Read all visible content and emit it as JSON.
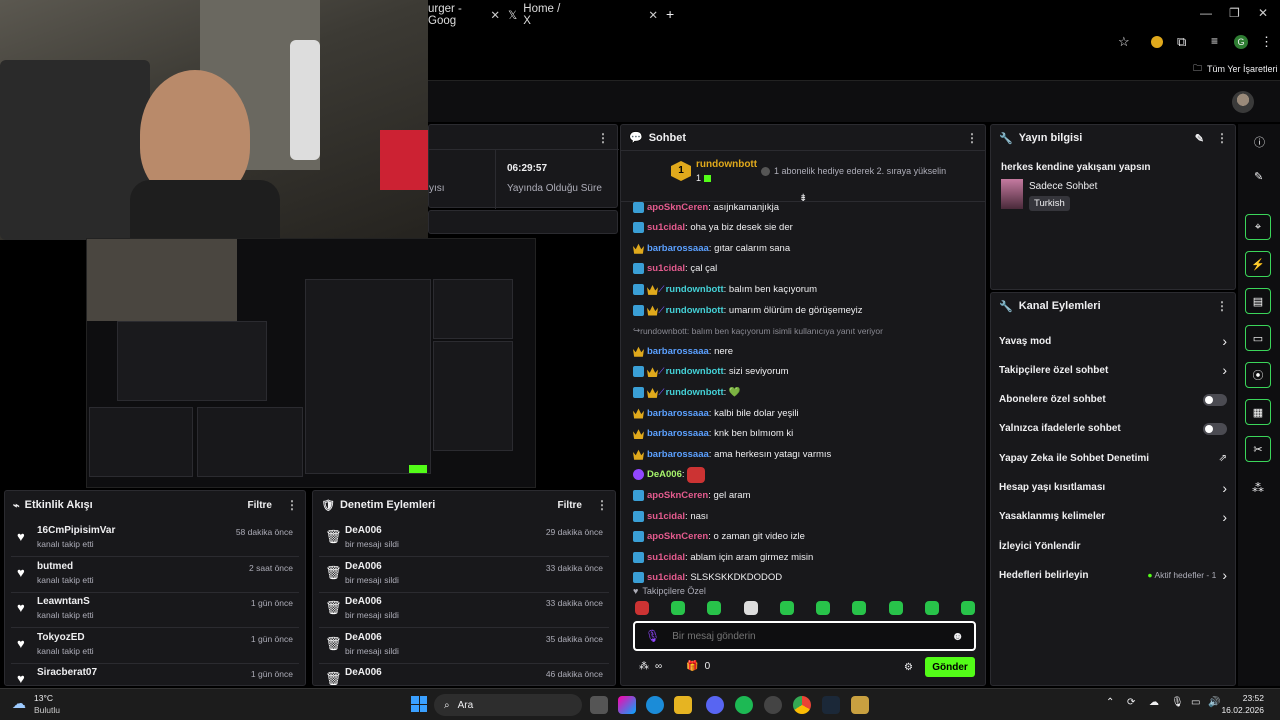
{
  "browser": {
    "tabs": [
      {
        "label": "urger - Goog"
      },
      {
        "label": "Home / X"
      }
    ],
    "bookmarks_label": "Tüm Yer İşaretleri",
    "profile_initial": "G"
  },
  "stats": {
    "uptime_value": "06:29:57",
    "uptime_label": "Yayında Olduğu Süre",
    "left_partial": "yısı"
  },
  "chat": {
    "title": "Sohbet",
    "pinned": {
      "rank": "1",
      "user": "rundownbott",
      "sub": "1",
      "text": "1 abonelik hediye ederek 2. sıraya yükselin"
    },
    "messages": [
      {
        "user": "apoSknCeren",
        "text": "asıjnkamanjıkja",
        "badges": [
          "blue"
        ],
        "color": "u-pink"
      },
      {
        "user": "su1cidal",
        "text": "oha ya biz desek sie der",
        "badges": [
          "blue"
        ],
        "color": "u-pink"
      },
      {
        "user": "barbarossaaa",
        "text": "gıtar calarım sana",
        "badges": [
          "gold"
        ],
        "color": "u-blue"
      },
      {
        "user": "su1cidal",
        "text": "çal çal",
        "badges": [
          "blue"
        ],
        "color": "u-pink"
      },
      {
        "user": "rundownbott",
        "text": "balım ben kaçıyorum",
        "badges": [
          "blue",
          "gold"
        ],
        "color": "u-cyan",
        "mod": true
      },
      {
        "user": "rundownbott",
        "text": "umarım ölürüm de görüşemeyiz",
        "badges": [
          "blue",
          "gold"
        ],
        "color": "u-cyan",
        "mod": true
      },
      {
        "reply": "rundownbott: balım ben kaçıyorum isimli kullanıcıya yanıt veriyor"
      },
      {
        "user": "barbarossaaa",
        "text": "nere",
        "badges": [
          "gold"
        ],
        "color": "u-blue"
      },
      {
        "user": "rundownbott",
        "text": "sizi seviyorum",
        "badges": [
          "blue",
          "gold"
        ],
        "color": "u-cyan",
        "mod": true
      },
      {
        "user": "rundownbott",
        "text": "💚",
        "badges": [
          "blue",
          "gold"
        ],
        "color": "u-cyan",
        "mod": true
      },
      {
        "user": "barbarossaaa",
        "text": "kalbi bile dolar yeşili",
        "badges": [
          "gold"
        ],
        "color": "u-blue"
      },
      {
        "user": "barbarossaaa",
        "text": "knk ben bılmıom ki",
        "badges": [
          "gold"
        ],
        "color": "u-blue"
      },
      {
        "user": "barbarossaaa",
        "text": "ama herkesın yatagı varmıs",
        "badges": [
          "gold"
        ],
        "color": "u-blue"
      },
      {
        "user": "DeA006",
        "text": "",
        "badges": [
          "mic"
        ],
        "color": "u-lime",
        "emote": true
      },
      {
        "user": "apoSknCeren",
        "text": "gel aram",
        "badges": [
          "blue"
        ],
        "color": "u-pink"
      },
      {
        "user": "su1cidal",
        "text": "nası",
        "badges": [
          "blue"
        ],
        "color": "u-pink"
      },
      {
        "user": "apoSknCeren",
        "text": "o zaman git video izle",
        "badges": [
          "blue"
        ],
        "color": "u-pink"
      },
      {
        "user": "su1cidal",
        "text": "ablam için aram girmez misin",
        "badges": [
          "blue"
        ],
        "color": "u-pink"
      },
      {
        "user": "su1cidal",
        "text": "SLSKSKKDKDODOD",
        "badges": [
          "blue"
        ],
        "color": "u-pink"
      }
    ],
    "followers_only_label": "Takipçilere Özel",
    "input_placeholder": "Bir mesaj gönderin",
    "infinity": "∞",
    "gift_count": "0",
    "send_label": "Gönder"
  },
  "stream_info": {
    "title": "Yayın bilgisi",
    "stream_title": "herkes kendine yakışanı yapsın",
    "category": "Sadece Sohbet",
    "tag": "Turkish"
  },
  "channel_actions": {
    "title": "Kanal Eylemleri",
    "rows": [
      {
        "label": "Yavaş mod",
        "control": "chevron"
      },
      {
        "label": "Takipçilere özel sohbet",
        "control": "chevron"
      },
      {
        "label": "Abonelere özel sohbet",
        "control": "toggle"
      },
      {
        "label": "Yalnızca ifadelerle sohbet",
        "control": "toggle"
      },
      {
        "label": "Yapay Zeka ile Sohbet Denetimi",
        "control": "external"
      },
      {
        "label": "Hesap yaşı kısıtlaması",
        "control": "chevron"
      },
      {
        "label": "Yasaklanmış kelimeler",
        "control": "chevron"
      },
      {
        "label": "İzleyici Yönlendir",
        "control": "none"
      },
      {
        "label": "Hedefleri belirleyin",
        "control": "goal",
        "extra": "Aktif hedefler - 1"
      }
    ]
  },
  "activity_feed": {
    "title": "Etkinlik Akışı",
    "filter": "Filtre",
    "items": [
      {
        "name": "16CmPipisimVar",
        "action": "kanalı takip etti",
        "time": "58 dakika önce"
      },
      {
        "name": "butmed",
        "action": "kanalı takip etti",
        "time": "2 saat önce"
      },
      {
        "name": "LeawntanS",
        "action": "kanalı takip etti",
        "time": "1 gün önce"
      },
      {
        "name": "TokyozED",
        "action": "kanalı takip etti",
        "time": "1 gün önce"
      },
      {
        "name": "Siracberat07",
        "action": "",
        "time": "1 gün önce"
      }
    ]
  },
  "mod_actions": {
    "title": "Denetim Eylemleri",
    "filter": "Filtre",
    "items": [
      {
        "name": "DeA006",
        "action": "bir mesajı sildi",
        "time": "29 dakika önce"
      },
      {
        "name": "DeA006",
        "action": "bir mesajı sildi",
        "time": "33 dakika önce"
      },
      {
        "name": "DeA006",
        "action": "bir mesajı sildi",
        "time": "33 dakika önce"
      },
      {
        "name": "DeA006",
        "action": "bir mesajı sildi",
        "time": "35 dakika önce"
      },
      {
        "name": "DeA006",
        "action": "",
        "time": "46 dakika önce"
      }
    ]
  },
  "taskbar": {
    "weather_temp": "13°C",
    "weather_desc": "Bulutlu",
    "search_label": "Ara",
    "time": "23:52",
    "date": "16.02.2026"
  },
  "colors": {
    "accent": "#53fc18",
    "panel": "#18181b"
  }
}
